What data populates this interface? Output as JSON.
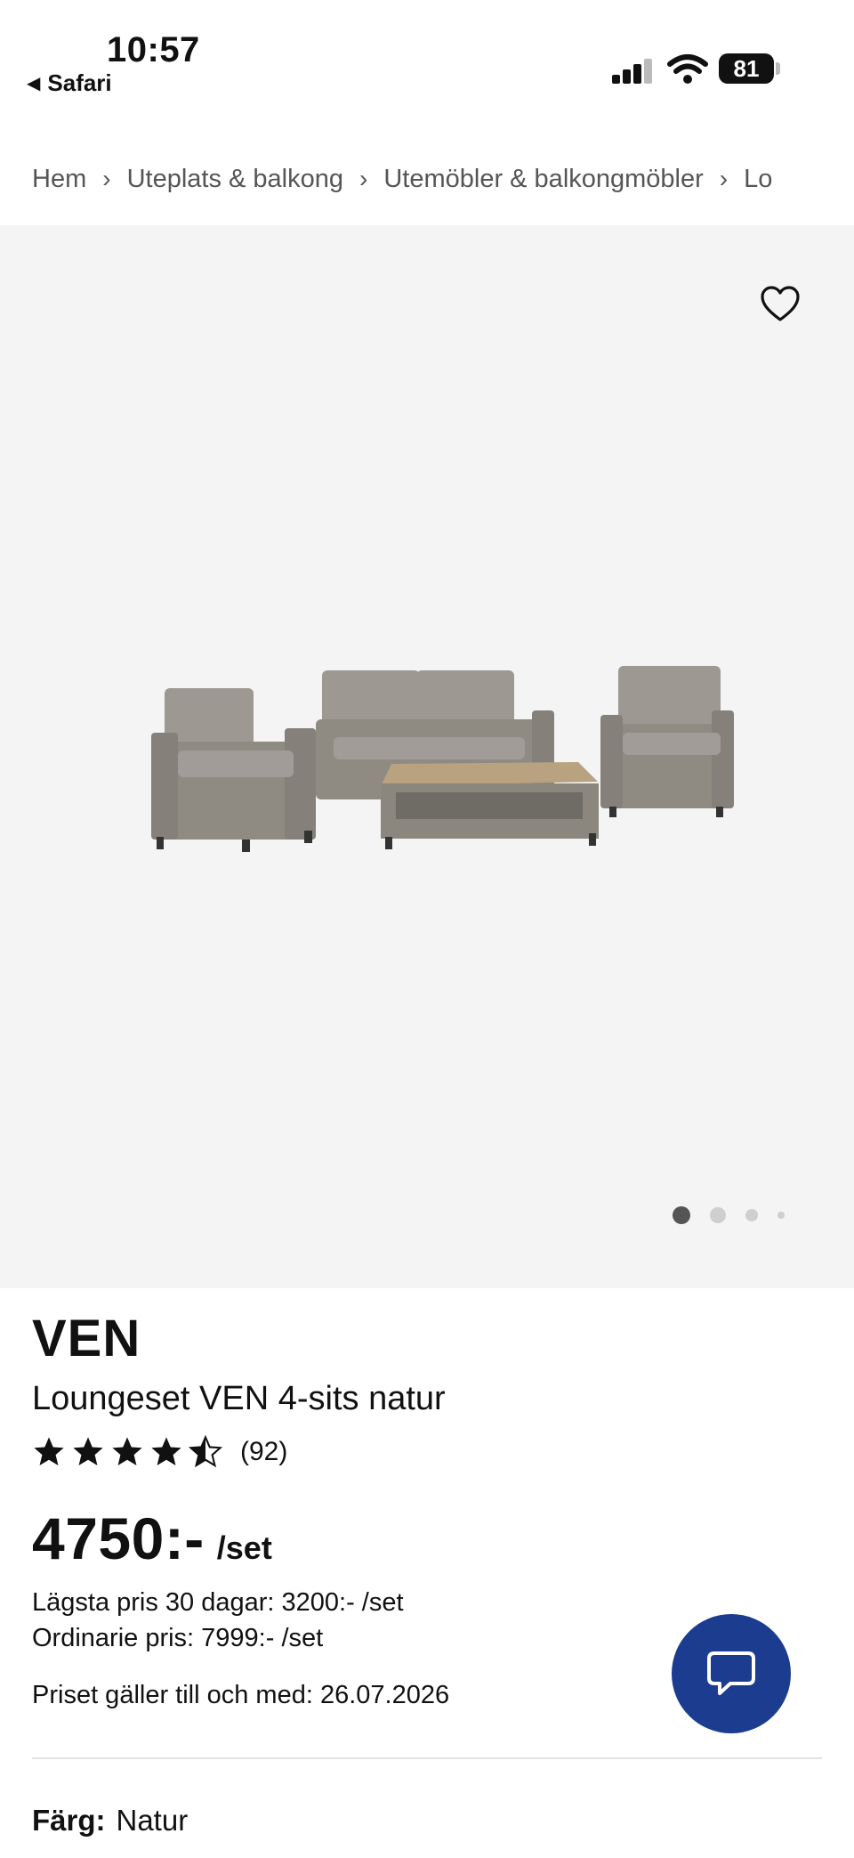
{
  "status_bar": {
    "time": "10:57",
    "back_label": "Safari",
    "battery": "81"
  },
  "breadcrumb": [
    "Hem",
    "Uteplats & balkong",
    "Utemöbler & balkongmöbler",
    "Lo"
  ],
  "gallery": {
    "active_slide": 1,
    "slide_count": 4,
    "image_alt": "Loungeset VEN 4-sits natur"
  },
  "product": {
    "brand": "VEN",
    "name": "Loungeset VEN 4-sits natur",
    "rating": 4.5,
    "rating_count": "(92)",
    "price": "4750:-",
    "price_unit": "/set",
    "lowest_price": "Lägsta pris 30 dagar: 3200:- /set",
    "regular_price": "Ordinarie pris: 7999:- /set",
    "valid_until": "Priset gäller till och med: 26.07.2026",
    "color_label": "Färg:",
    "color_value": "Natur"
  },
  "colors": {
    "chat_button": "#1b3c8f",
    "gallery_bg": "#f4f4f5"
  },
  "icons": [
    "back-arrow-icon",
    "signal-icon",
    "wifi-icon",
    "battery-icon",
    "heart-icon",
    "star-icon",
    "chat-icon"
  ]
}
